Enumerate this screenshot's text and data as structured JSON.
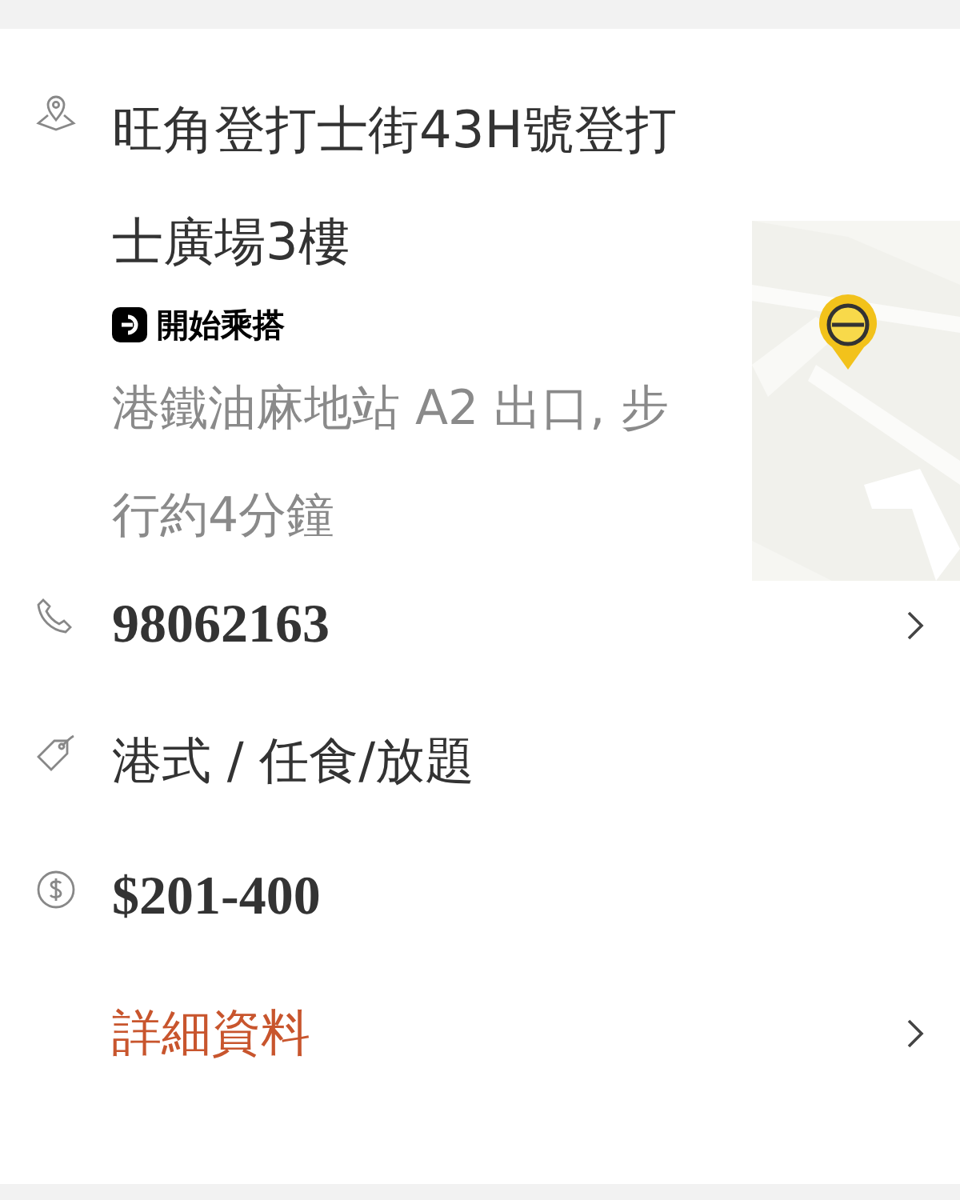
{
  "address": {
    "text": "旺角登打士街43H號登打士廣場3樓",
    "ride_link": "開始乘搭",
    "directions": "港鐵油麻地站 A2 出口, 步行約4分鐘"
  },
  "rows": [
    {
      "kind": "phone",
      "text": "98062163",
      "chevron": true
    },
    {
      "kind": "category",
      "text": "港式 / 任食/放題",
      "chevron": false
    },
    {
      "kind": "price",
      "text": "$201-400",
      "chevron": false
    },
    {
      "kind": "details",
      "text": "詳細資料",
      "chevron": true
    }
  ]
}
